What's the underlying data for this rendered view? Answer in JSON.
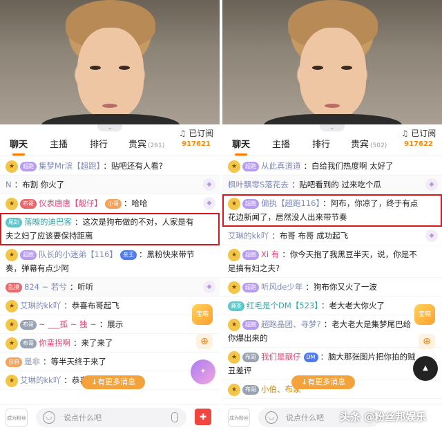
{
  "tabs": {
    "chat": "聊天",
    "host": "主播",
    "rank": "排行",
    "guests": "贵宾"
  },
  "subscribe_label": "已订阅",
  "left": {
    "guest_count": "(261)",
    "sub_count": "917621",
    "messages": [
      {
        "badge": "超跑",
        "nick": "集梦Mr滨【超跑】",
        "text": "：贴吧还有人看?"
      },
      {
        "nick": "N",
        "text": "：布割 你火了"
      },
      {
        "badge": "布哥",
        "nick": "仪表唐唐【靓仔】",
        "tag": "小哥",
        "text": "：哈哈"
      },
      {
        "badge": "尾趴",
        "nick": "落魄的迪巴客",
        "text": "：这次是狗布做的不对，人家是有夫之妇了应该要保持距离"
      },
      {
        "badge": "超跑",
        "nick": "队长的小迷弟【116】",
        "tag": "亲王",
        "text": "：黑粉快来带节奏，弹幕有点少阿"
      },
      {
        "badge": "乱摸",
        "nick": "824 ~ 若兮",
        "text": "：听听"
      },
      {
        "nick": "艾琳的kk吖",
        "text": "：恭喜布哥起飞"
      },
      {
        "badge": "布哥",
        "nick": "~ ___孤 ~ 独 ~",
        "text": "：展示"
      },
      {
        "badge": "布哥",
        "nick": "你蛮拐啊",
        "text": "：来了来了"
      },
      {
        "badge": "吕府",
        "nick": "是非",
        "text": "：等半天终于来了"
      },
      {
        "nick": "艾琳的kk吖",
        "text": "：恭喜布哥起飞"
      }
    ],
    "more_label": "↓有更多消息",
    "placeholder": "说点什么吧"
  },
  "right": {
    "guest_count": "(502)",
    "sub_count": "917622",
    "messages": [
      {
        "badge": "超跑",
        "nick": "从此真道道",
        "text": "：白给我们热度啊 太好了"
      },
      {
        "nick": "枫叶飘零S落花去",
        "text": "：贴吧看到的 过来吃个瓜"
      },
      {
        "badge": "超跑",
        "nick": "偏执【超跑116】",
        "text": "：阿布，你凉了，终于有点花边新闻了，居然没人出来带节奏"
      },
      {
        "nick": "艾琳的kk吖",
        "text": "：布哥 布哥 成功起飞"
      },
      {
        "badge": "超跑",
        "nick": "Xi 有",
        "text": "：你今天抱了我黑豆半天，说，你是不是搞有妇之夫?"
      },
      {
        "badge": "超跑",
        "nick": "听风de少年",
        "text": "：狗布你又火了一波"
      },
      {
        "badge": "骚圣",
        "nick": "红毛是个DM【523】",
        "text": "：老大老大你火了"
      },
      {
        "badge": "超跑",
        "nick": "超跑晶团、寻梦?",
        "text": "：老大老大是集梦尾巴给你爆出来的"
      },
      {
        "badge": "布哥",
        "nick": "我们是靓仔",
        "tag": "DM",
        "text": "：脑大那张图片把你拍的贼丑差评"
      },
      {
        "badge": "布哥",
        "nick": "小伯、布家",
        "text": ""
      }
    ],
    "more_label": "↓有更多消息",
    "placeholder": "说点什么吧"
  },
  "fan_label": "成为粉丝",
  "watermark": "头条 @粉丝邦娱乐"
}
